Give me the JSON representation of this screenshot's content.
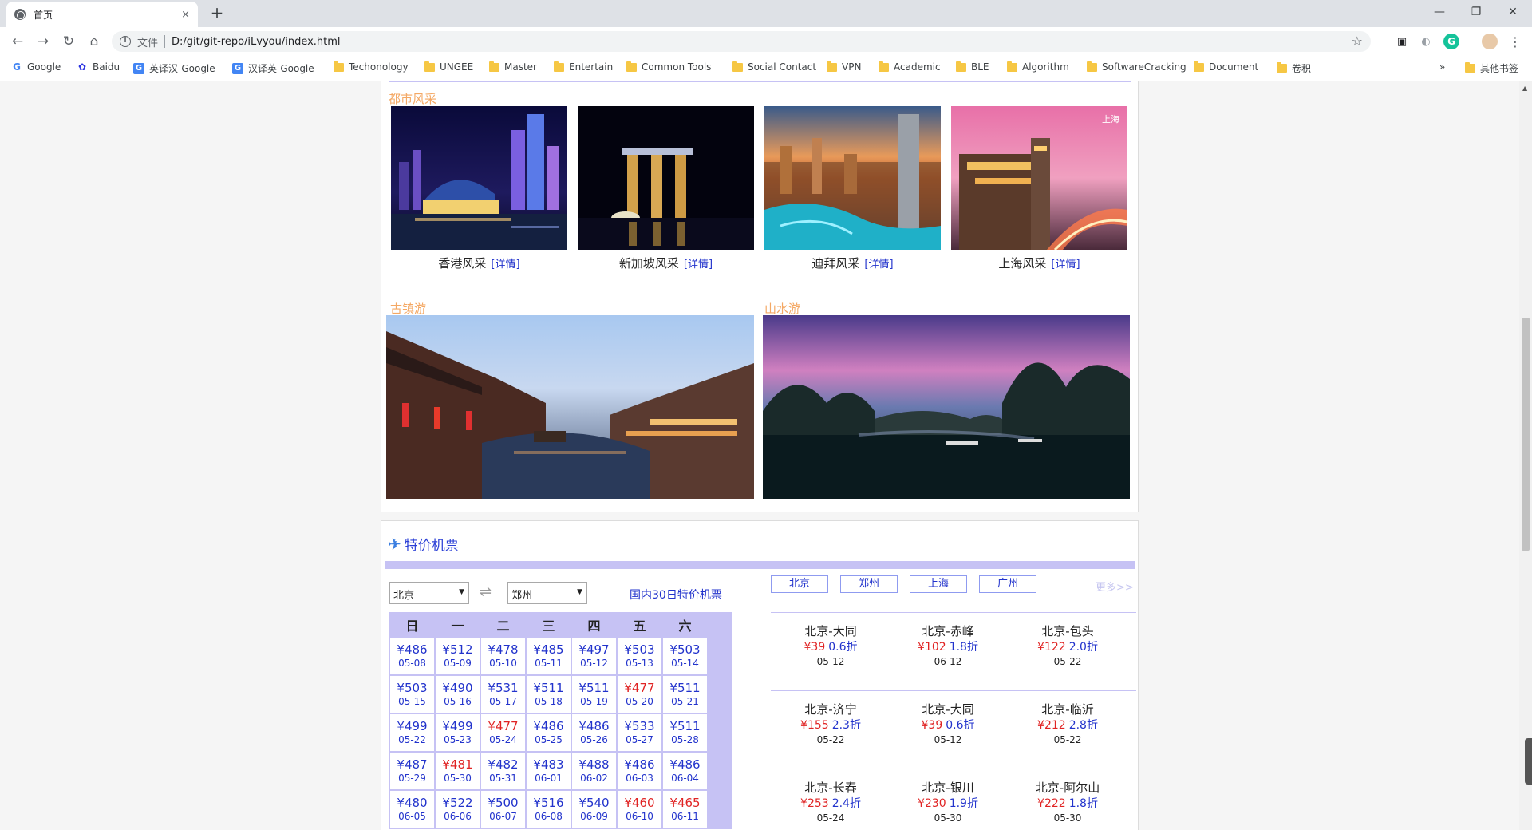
{
  "browser": {
    "tab_title": "首页",
    "tab_close": "×",
    "new_tab": "+",
    "scheme_label": "文件",
    "url": "D:/git/git-repo/iLvyou/index.html"
  },
  "bookmarks": [
    {
      "label": "Google",
      "icon": "google-icon"
    },
    {
      "label": "Baidu",
      "icon": "baidu-icon"
    },
    {
      "label": "英译汉-Google",
      "icon": "translate-icon"
    },
    {
      "label": "汉译英-Google",
      "icon": "translate-icon"
    },
    {
      "label": "Techonology",
      "icon": "folder-icon"
    },
    {
      "label": "UNGEE",
      "icon": "folder-icon"
    },
    {
      "label": "Master",
      "icon": "folder-icon"
    },
    {
      "label": "Entertain",
      "icon": "folder-icon"
    },
    {
      "label": "Common Tools",
      "icon": "folder-icon"
    },
    {
      "label": "Social Contact",
      "icon": "folder-icon"
    },
    {
      "label": "VPN",
      "icon": "folder-icon"
    },
    {
      "label": "Academic",
      "icon": "folder-icon"
    },
    {
      "label": "BLE",
      "icon": "folder-icon"
    },
    {
      "label": "Algorithm",
      "icon": "folder-icon"
    },
    {
      "label": "SoftwareCracking",
      "icon": "folder-icon"
    },
    {
      "label": "Document",
      "icon": "folder-icon"
    },
    {
      "label": "卷积",
      "icon": "folder-icon"
    }
  ],
  "bookmarks_overflow": "»",
  "bookmarks_other": "其他书签",
  "city_section": {
    "title": "都市风采",
    "detail_label": "[详情]",
    "cities": [
      {
        "name": "香港风采"
      },
      {
        "name": "新加坡风采"
      },
      {
        "name": "迪拜风采"
      },
      {
        "name": "上海风采"
      }
    ],
    "shanghai_watermark": "上海"
  },
  "town_section": {
    "title": "古镇游"
  },
  "landscape_section": {
    "title": "山水游"
  },
  "flights": {
    "title": "特价机票",
    "from_city": "北京",
    "to_city": "郑州",
    "thirty_day_link": "国内30日特价机票",
    "weekdays": [
      "日",
      "一",
      "二",
      "三",
      "四",
      "五",
      "六"
    ],
    "calendar": [
      [
        {
          "p": "¥486",
          "d": "05-08"
        },
        {
          "p": "¥512",
          "d": "05-09"
        },
        {
          "p": "¥478",
          "d": "05-10"
        },
        {
          "p": "¥485",
          "d": "05-11"
        },
        {
          "p": "¥497",
          "d": "05-12"
        },
        {
          "p": "¥503",
          "d": "05-13"
        },
        {
          "p": "¥503",
          "d": "05-14"
        }
      ],
      [
        {
          "p": "¥503",
          "d": "05-15"
        },
        {
          "p": "¥490",
          "d": "05-16"
        },
        {
          "p": "¥531",
          "d": "05-17"
        },
        {
          "p": "¥511",
          "d": "05-18"
        },
        {
          "p": "¥511",
          "d": "05-19"
        },
        {
          "p": "¥477",
          "d": "05-20",
          "low": true
        },
        {
          "p": "¥511",
          "d": "05-21"
        }
      ],
      [
        {
          "p": "¥499",
          "d": "05-22"
        },
        {
          "p": "¥499",
          "d": "05-23"
        },
        {
          "p": "¥477",
          "d": "05-24",
          "low": true
        },
        {
          "p": "¥486",
          "d": "05-25"
        },
        {
          "p": "¥486",
          "d": "05-26"
        },
        {
          "p": "¥533",
          "d": "05-27"
        },
        {
          "p": "¥511",
          "d": "05-28"
        }
      ],
      [
        {
          "p": "¥487",
          "d": "05-29"
        },
        {
          "p": "¥481",
          "d": "05-30",
          "low": true
        },
        {
          "p": "¥482",
          "d": "05-31"
        },
        {
          "p": "¥483",
          "d": "06-01"
        },
        {
          "p": "¥488",
          "d": "06-02"
        },
        {
          "p": "¥486",
          "d": "06-03"
        },
        {
          "p": "¥486",
          "d": "06-04"
        }
      ],
      [
        {
          "p": "¥480",
          "d": "06-05"
        },
        {
          "p": "¥522",
          "d": "06-06"
        },
        {
          "p": "¥500",
          "d": "06-07"
        },
        {
          "p": "¥516",
          "d": "06-08"
        },
        {
          "p": "¥540",
          "d": "06-09"
        },
        {
          "p": "¥460",
          "d": "06-10",
          "low": true
        },
        {
          "p": "¥465",
          "d": "06-11",
          "low": true
        }
      ]
    ],
    "city_tabs": [
      "北京",
      "郑州",
      "上海",
      "广州"
    ],
    "more_label": "更多>>",
    "deals": [
      {
        "route": "北京-大同",
        "price": "¥39",
        "discount": "0.6折",
        "date": "05-12"
      },
      {
        "route": "北京-赤峰",
        "price": "¥102",
        "discount": "1.8折",
        "date": "06-12"
      },
      {
        "route": "北京-包头",
        "price": "¥122",
        "discount": "2.0折",
        "date": "05-22"
      },
      {
        "route": "北京-济宁",
        "price": "¥155",
        "discount": "2.3折",
        "date": "05-22"
      },
      {
        "route": "北京-大同",
        "price": "¥39",
        "discount": "0.6折",
        "date": "05-12"
      },
      {
        "route": "北京-临沂",
        "price": "¥212",
        "discount": "2.8折",
        "date": "05-22"
      },
      {
        "route": "北京-长春",
        "price": "¥253",
        "discount": "2.4折",
        "date": "05-24"
      },
      {
        "route": "北京-银川",
        "price": "¥230",
        "discount": "1.9折",
        "date": "05-30"
      },
      {
        "route": "北京-阿尔山",
        "price": "¥222",
        "discount": "1.8折",
        "date": "05-30"
      }
    ]
  }
}
